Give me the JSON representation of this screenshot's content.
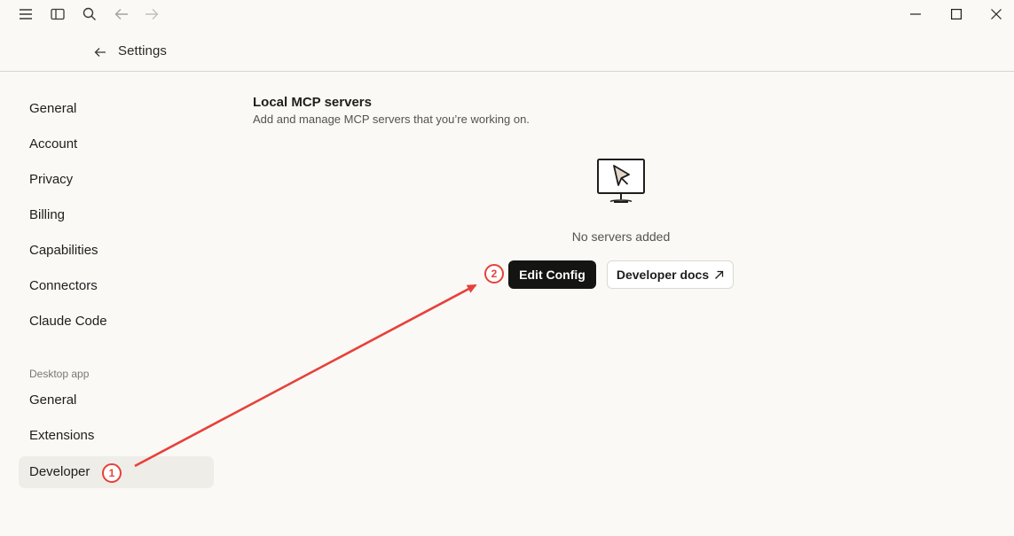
{
  "titlebar": {
    "icons": [
      "menu-icon",
      "sidebar-toggle-icon",
      "search-icon",
      "back-icon",
      "forward-icon",
      "minimize-icon",
      "maximize-icon",
      "close-icon"
    ]
  },
  "header": {
    "title": "Settings"
  },
  "sidebar": {
    "items": [
      {
        "label": "General"
      },
      {
        "label": "Account"
      },
      {
        "label": "Privacy"
      },
      {
        "label": "Billing"
      },
      {
        "label": "Capabilities"
      },
      {
        "label": "Connectors"
      },
      {
        "label": "Claude Code"
      }
    ],
    "section_label": "Desktop app",
    "desktop_items": [
      {
        "label": "General"
      },
      {
        "label": "Extensions"
      },
      {
        "label": "Developer",
        "active": true
      }
    ]
  },
  "main": {
    "title": "Local MCP servers",
    "subtitle": "Add and manage MCP servers that you’re working on.",
    "empty_text": "No servers added",
    "edit_config_label": "Edit Config",
    "developer_docs_label": "Developer docs"
  },
  "annotations": {
    "badge1": "1",
    "badge2": "2",
    "arrow_color": "#e8403a"
  }
}
